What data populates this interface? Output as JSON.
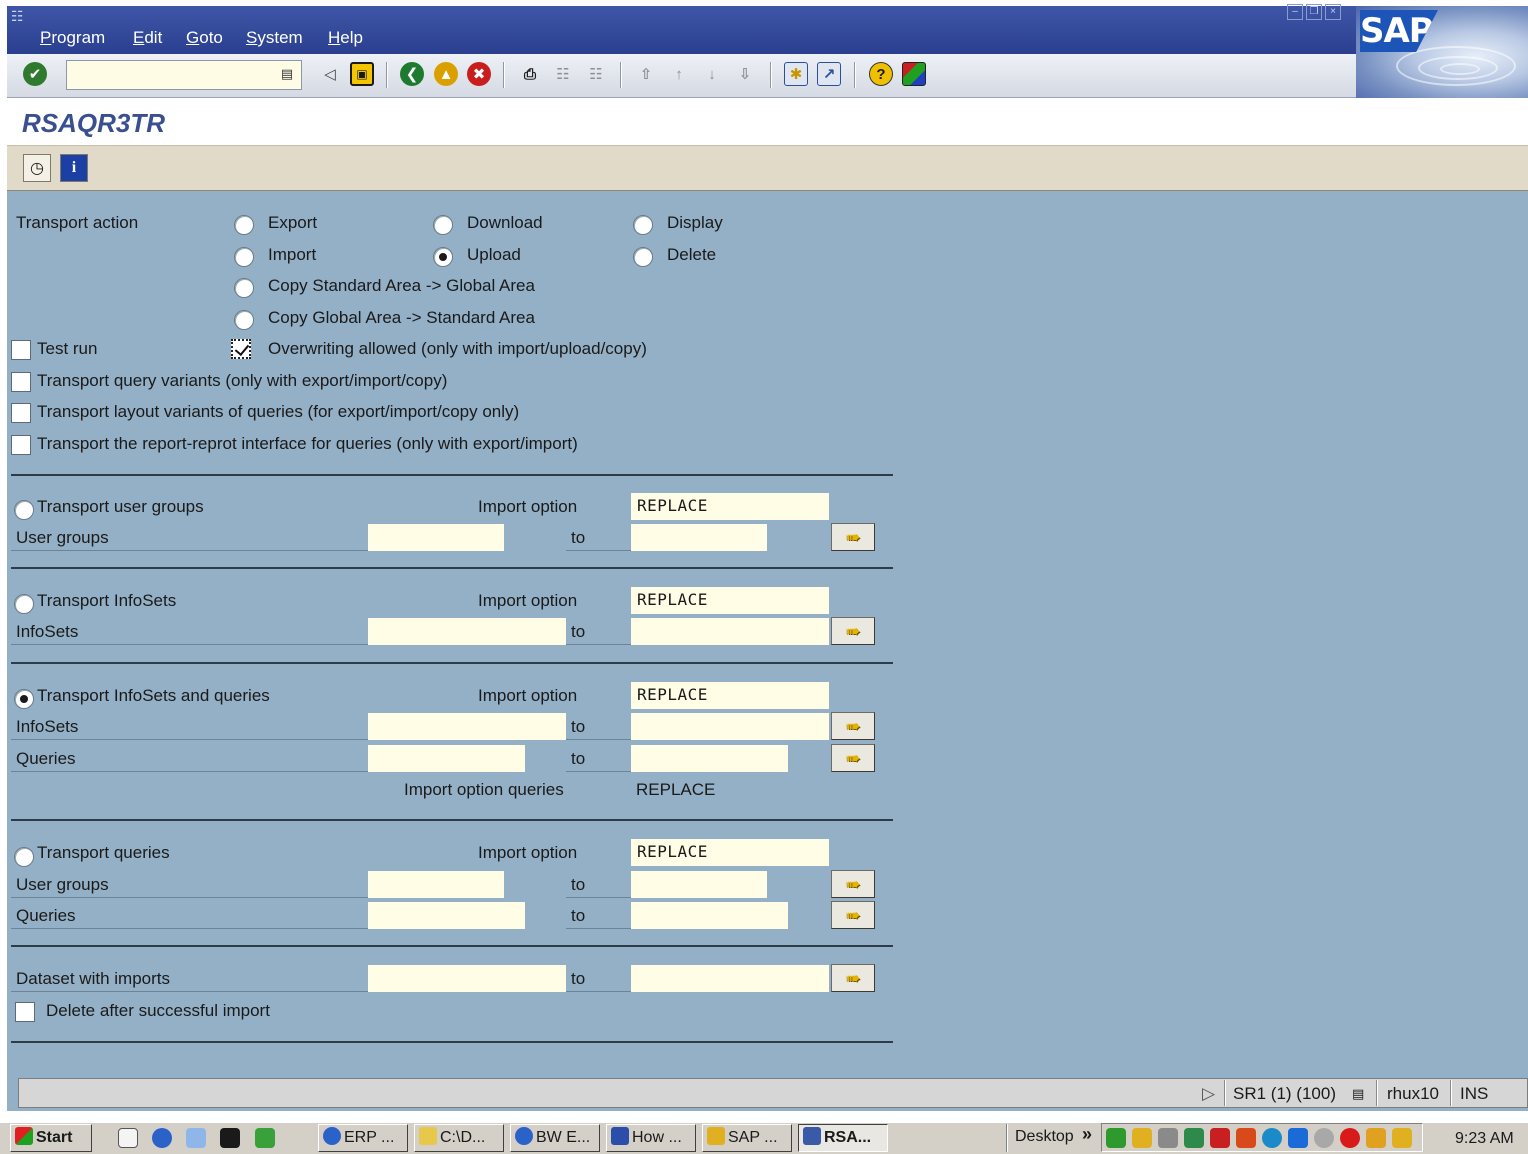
{
  "menu": {
    "items": [
      {
        "label": "Program",
        "u": "P",
        "rest": "rogram"
      },
      {
        "label": "Edit",
        "u": "E",
        "rest": "dit"
      },
      {
        "label": "Goto",
        "u": "G",
        "rest": "oto"
      },
      {
        "label": "System",
        "u": "S",
        "rest": "ystem"
      },
      {
        "label": "Help",
        "u": "H",
        "rest": "elp"
      }
    ]
  },
  "brand": {
    "logo_text": "SAP"
  },
  "toolbar": {
    "command_value": ""
  },
  "page": {
    "title": "RSAQR3TR"
  },
  "transport": {
    "label": "Transport action",
    "options": {
      "export": "Export",
      "download": "Download",
      "display": "Display",
      "import": "Import",
      "upload": "Upload",
      "delete": "Delete",
      "copy_std_global": "Copy Standard Area -> Global Area",
      "copy_global_std": "Copy Global Area -> Standard Area"
    },
    "selected": "upload"
  },
  "checks": {
    "test_run": "Test run",
    "overwrite": "Overwriting allowed (only with import/upload/copy)",
    "query_variants": "Transport query variants (only with export/import/copy)",
    "layout_variants": "Transport layout variants of queries (for export/import/copy only)",
    "report_interface": "Transport the report-reprot interface for queries (only with export/import)",
    "delete_after": "Delete after successful import"
  },
  "common": {
    "import_option": "Import option",
    "to": "to",
    "replace": "REPLACE"
  },
  "sections": {
    "user_groups": {
      "radio": "Transport user groups",
      "row1": "User groups"
    },
    "infosets": {
      "radio": "Transport InfoSets",
      "row1": "InfoSets"
    },
    "infosets_queries": {
      "radio": "Transport InfoSets and queries",
      "row1": "InfoSets",
      "row2": "Queries",
      "iopt_queries_label": "Import option queries",
      "iopt_queries_value": "REPLACE"
    },
    "queries": {
      "radio": "Transport queries",
      "row1": "User groups",
      "row2": "Queries"
    },
    "dataset": {
      "row1": "Dataset with imports"
    }
  },
  "status": {
    "system": "SR1 (1) (100)",
    "server": "rhux10",
    "mode": "INS"
  },
  "taskbar": {
    "start": "Start",
    "tasks": [
      "ERP ...",
      "C:\\D...",
      "BW E...",
      "How ...",
      "SAP ...",
      "RSA..."
    ],
    "desktop": "Desktop",
    "chevron": "»",
    "clock": "9:23 AM"
  },
  "colors": {
    "content_bg": "#94b0c6",
    "input_bg": "#fffde6",
    "title_blue": "#3a4f8f",
    "menubar_blue": "#2a3f8f"
  }
}
